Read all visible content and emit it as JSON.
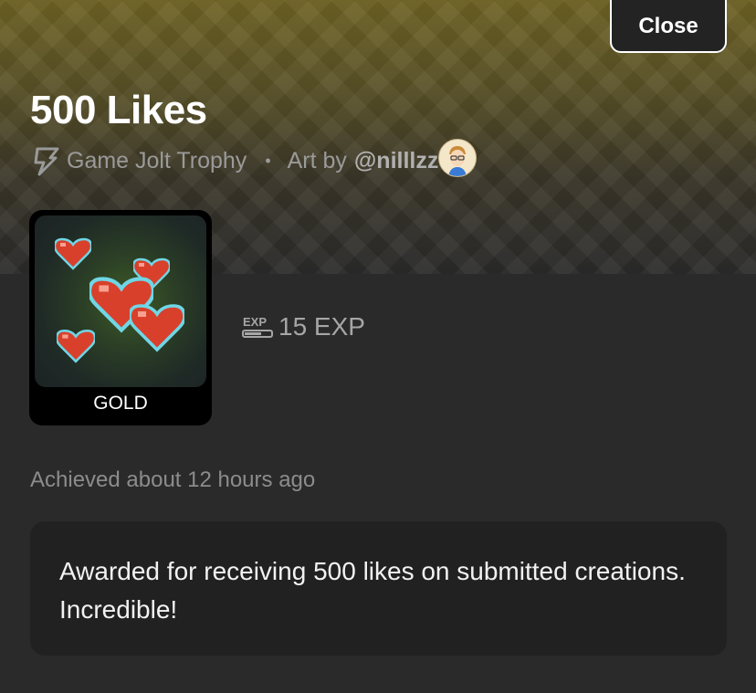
{
  "header": {
    "close_label": "Close"
  },
  "trophy": {
    "title": "500 Likes",
    "type_label": "Game Jolt Trophy",
    "separator": "•",
    "art_by_label": "Art by",
    "artist_handle": "@nilllzz",
    "tier": "GOLD",
    "exp": "15 EXP",
    "achieved": "Achieved about 12 hours ago",
    "description": "Awarded for receiving 500 likes on submitted creations. Incredible!"
  },
  "icons": {
    "bolt": "lightning-bolt-icon",
    "exp": "exp-icon",
    "avatar": "artist-avatar"
  },
  "colors": {
    "background": "#2a2a2a",
    "header_gold": "#6e6224",
    "muted_text": "#9a9a9a",
    "description_bg": "#212121",
    "heart_red": "#d8402c",
    "heart_outline": "#6fd6e6"
  }
}
